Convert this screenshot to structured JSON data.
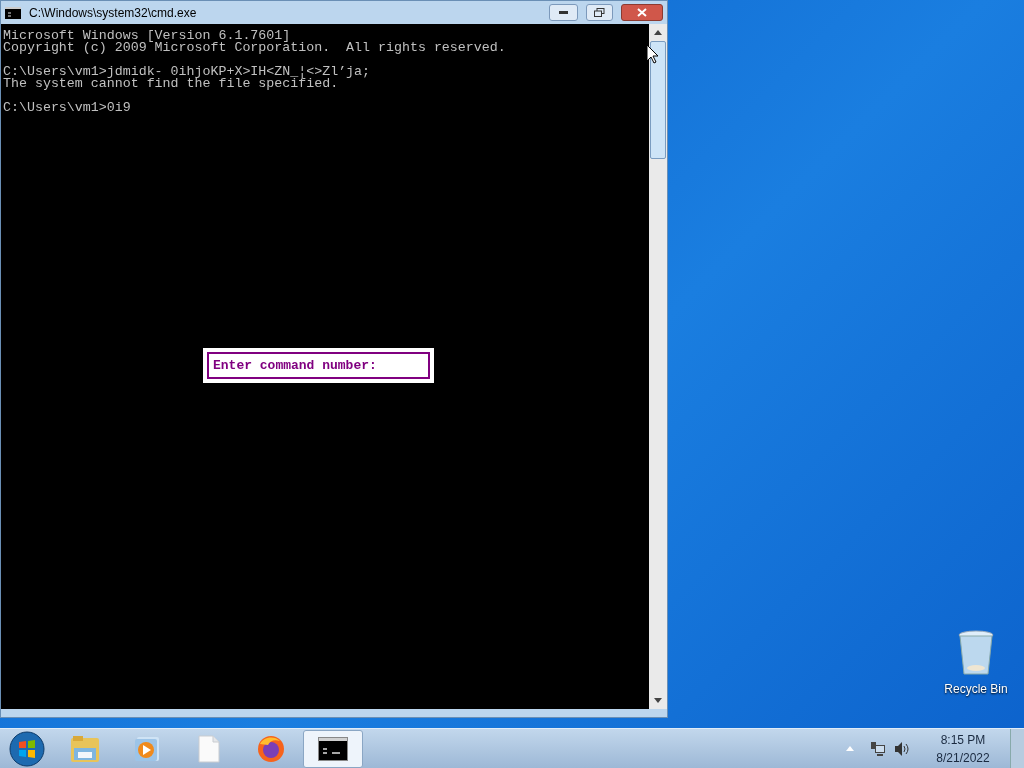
{
  "window": {
    "title": "C:\\Windows\\system32\\cmd.exe",
    "active": true
  },
  "console": {
    "lines": [
      {
        "text": "Microsoft Windows [Version 6.1.7601]",
        "blank_before": false
      },
      {
        "text": "Copyright (c) 2009 Microsoft Corporation.  All rights reserved.",
        "blank_before": false
      },
      {
        "text": "C:\\Users\\vm1>jdmidk- 0ihjoKP+X>IH<ZN_¦<>Zl’ja;",
        "blank_before": true
      },
      {
        "text": "The system cannot find the file specified.",
        "blank_before": false
      },
      {
        "text": "C:\\Users\\vm1>0i9",
        "blank_before": true
      }
    ]
  },
  "prompt_box": {
    "label": "Enter command number:"
  },
  "desktop_icons": [
    {
      "label": "Recycle Bin"
    }
  ],
  "taskbar": {
    "items": [
      {
        "kind": "explorer",
        "selected": false
      },
      {
        "kind": "media",
        "selected": false
      },
      {
        "kind": "file",
        "selected": false
      },
      {
        "kind": "firefox",
        "selected": false
      },
      {
        "kind": "console",
        "selected": true
      }
    ],
    "clock": {
      "time": "8:15 PM",
      "date": "8/21/2022"
    }
  }
}
